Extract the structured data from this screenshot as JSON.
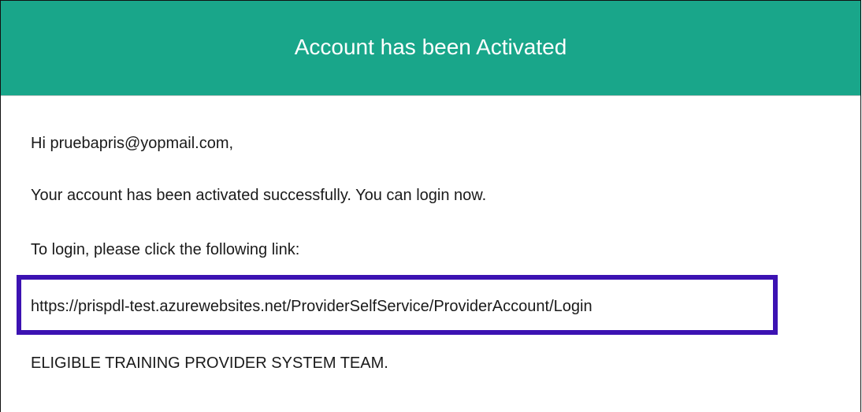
{
  "header": {
    "title": "Account has been Activated",
    "background_color": "#19a68a",
    "text_color": "#ffffff"
  },
  "body": {
    "greeting": "Hi pruebapris@yopmail.com,",
    "activation_message": "Your account has been activated successfully. You can login now.",
    "login_instruction": "To login, please click the following link:",
    "login_link": "https://prispdl-test.azurewebsites.net/ProviderSelfService/ProviderAccount/Login",
    "signature": "ELIGIBLE TRAINING PROVIDER SYSTEM TEAM."
  },
  "highlight": {
    "target": "login-link",
    "border_color": "#3c12b2"
  }
}
